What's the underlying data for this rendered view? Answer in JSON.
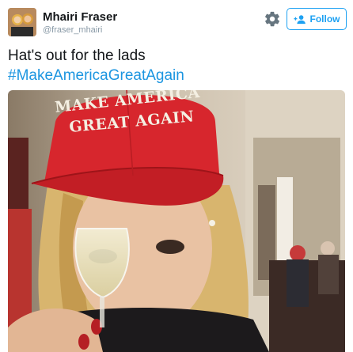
{
  "author": {
    "display_name": "Mhairi Fraser",
    "handle": "@fraser_mhairi"
  },
  "follow_button": {
    "label": "Follow",
    "icon": "add-user-icon",
    "color": "#1da1f2"
  },
  "settings_icon": "gear-icon",
  "tweet": {
    "text": "Hat's out for the lads",
    "hashtag": "#MakeAmericaGreatAgain",
    "hashtag_color": "#1b95e0"
  },
  "photo": {
    "hat_text_line1": "MAKE AMERICA",
    "hat_text_line2": "GREAT AGAIN",
    "hat_color": "#d7262d"
  }
}
